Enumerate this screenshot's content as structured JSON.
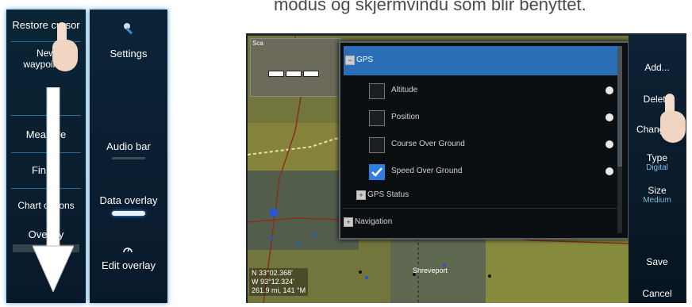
{
  "caption": "modus og skjermvindu som blir benyttet.",
  "left_menu": {
    "items": [
      "Restore cursor",
      "New waypoint...",
      "Measure",
      "Find...",
      "Chart options",
      "Overlay"
    ]
  },
  "overlay_menu": {
    "items": [
      {
        "label": "Settings",
        "icon": "wrench-icon"
      },
      {
        "label": "Audio bar"
      },
      {
        "label": "Data overlay"
      },
      {
        "label": "Edit overlay",
        "icon": "gauge-icon"
      }
    ]
  },
  "right_menu": {
    "add": "Add...",
    "delete": "Delete",
    "change": "Change...",
    "type_label": "Type",
    "type_value": "Digital",
    "size_label": "Size",
    "size_value": "Medium",
    "save": "Save",
    "cancel": "Cancel"
  },
  "dialog": {
    "header": "GPS",
    "rows": [
      {
        "label": "Altitude",
        "checked": false
      },
      {
        "label": "Position",
        "checked": false
      },
      {
        "label": "Course Over Ground",
        "checked": false
      },
      {
        "label": "Speed Over Ground",
        "checked": true
      }
    ],
    "group_gps_status": "GPS Status",
    "group_navigation": "Navigation"
  },
  "map": {
    "inset_label": "Sca",
    "city": "Shreveport",
    "coords": [
      "N  33°02.368'",
      "W  93°12.324'",
      "261.9 mi, 141 °M"
    ]
  },
  "colors": {
    "panel_glow": "#2a8cc8",
    "dialog_header": "#2a6eb8",
    "check_blue": "#2c7fe0"
  }
}
